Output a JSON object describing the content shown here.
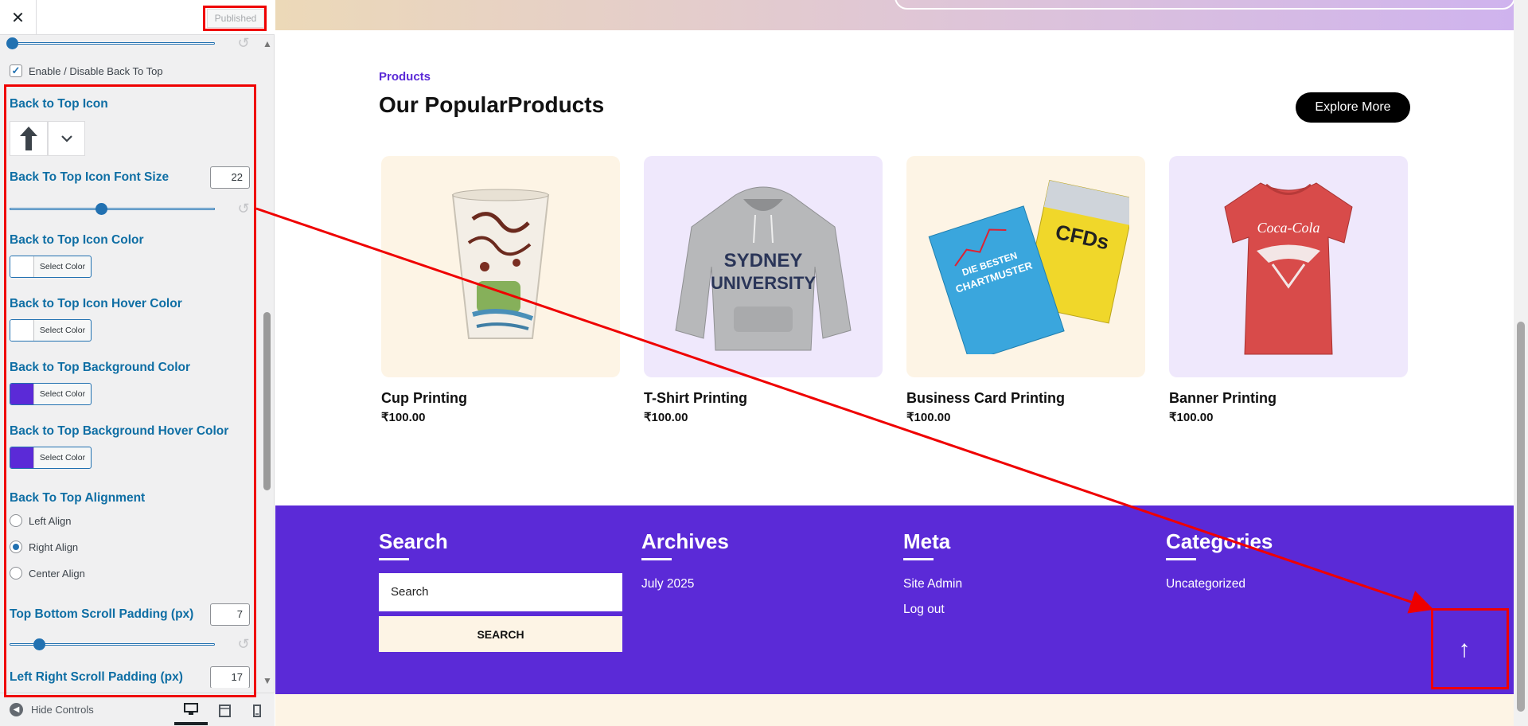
{
  "header": {
    "close_label": "✕",
    "publish_label": "Published"
  },
  "controls": {
    "enable_label": "Enable / Disable Back To Top",
    "icon_title": "Back to Top Icon",
    "font_size_title": "Back To Top Icon Font Size",
    "font_size_value": "22",
    "icon_color_title": "Back to Top Icon Color",
    "icon_hover_color_title": "Back to Top Icon Hover Color",
    "bg_color_title": "Back to Top Background Color",
    "bg_hover_color_title": "Back to Top Background Hover Color",
    "select_color_label": "Select Color",
    "alignment_title": "Back To Top Alignment",
    "align_left": "Left Align",
    "align_right": "Right Align",
    "align_center": "Center Align",
    "tb_padding_title": "Top Bottom Scroll Padding (px)",
    "tb_padding_value": "7",
    "lr_padding_title": "Left Right Scroll Padding (px)",
    "lr_padding_value": "17",
    "icon_color": "#ffffff",
    "icon_hover_color": "#ffffff",
    "bg_color": "#5b2ad7",
    "bg_hover_color": "#5b2ad7",
    "selected_alignment": "Right Align"
  },
  "footer_bar": {
    "hide_controls_label": "Hide Controls"
  },
  "preview": {
    "products_label": "Products",
    "products_title": "Our PopularProducts",
    "explore_label": "Explore More",
    "products": [
      {
        "name": "Cup Printing",
        "price": "₹100.00"
      },
      {
        "name": "T-Shirt Printing",
        "price": "₹100.00"
      },
      {
        "name": "Business Card Printing",
        "price": "₹100.00"
      },
      {
        "name": "Banner Printing",
        "price": "₹100.00"
      }
    ],
    "footer": {
      "search_title": "Search",
      "search_placeholder": "Search",
      "search_button": "SEARCH",
      "archives_title": "Archives",
      "archives_item": "July 2025",
      "meta_title": "Meta",
      "meta_items": [
        "Site Admin",
        "Log out"
      ],
      "categories_title": "Categories",
      "categories_item": "Uncategorized"
    },
    "back_to_top_icon": "↑"
  },
  "colors": {
    "accent": "#5b2ad7",
    "control_title": "#0e6ea4",
    "annotation": "#ef0000"
  }
}
